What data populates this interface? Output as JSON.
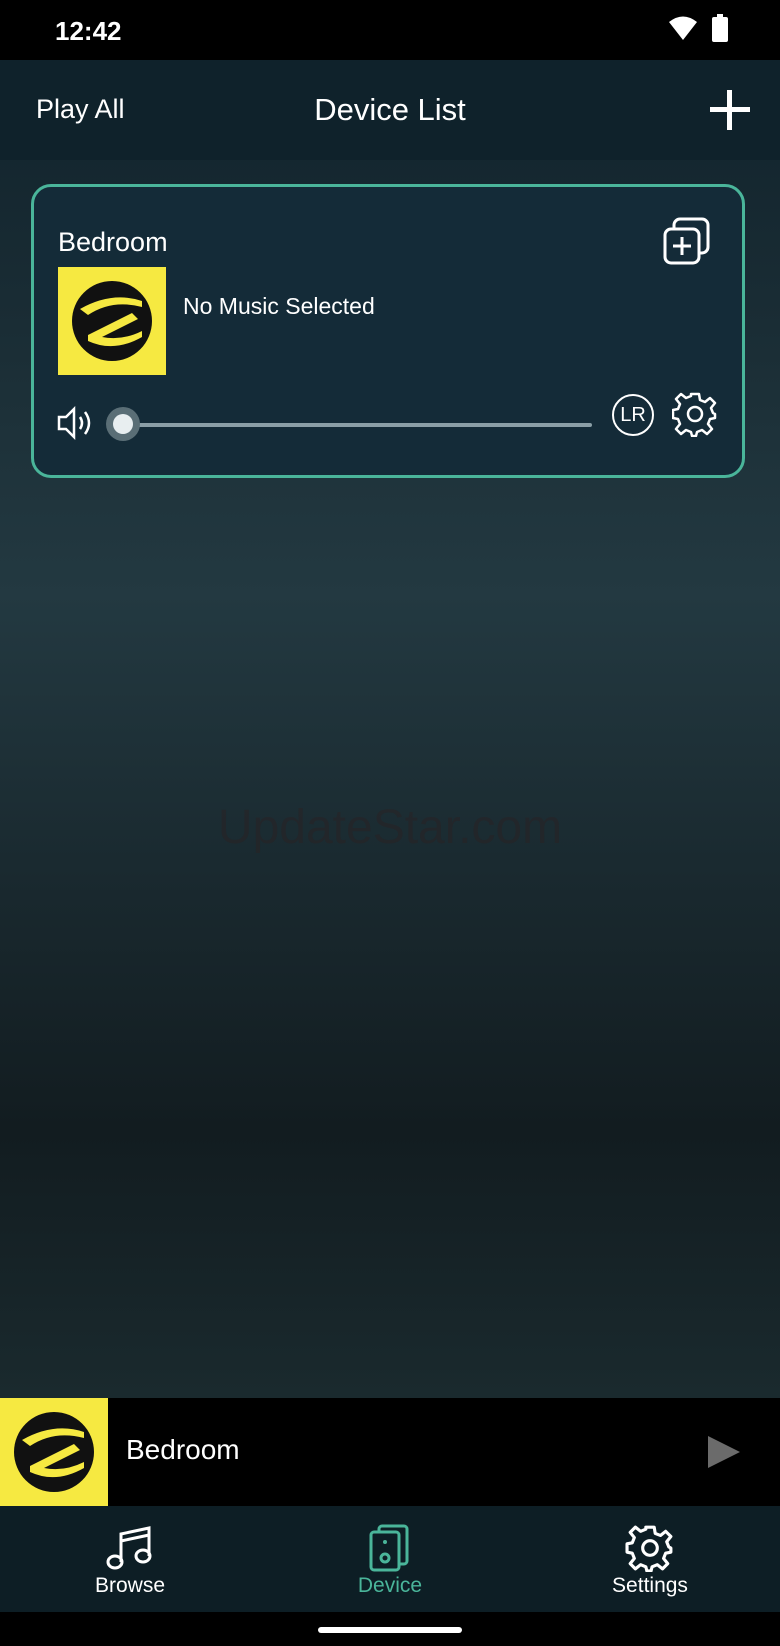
{
  "status": {
    "time": "12:42"
  },
  "header": {
    "play_all": "Play All",
    "title": "Device List"
  },
  "device": {
    "name": "Bedroom",
    "track": "No Music Selected",
    "lr_label": "LR",
    "volume": 0
  },
  "watermark": "UpdateStar.com",
  "mini_player": {
    "title": "Bedroom"
  },
  "tabs": [
    {
      "label": "Browse",
      "icon": "music-note-icon",
      "active": false
    },
    {
      "label": "Device",
      "icon": "speaker-icon",
      "active": true
    },
    {
      "label": "Settings",
      "icon": "gear-icon",
      "active": false
    }
  ],
  "colors": {
    "accent": "#4ab59a",
    "art_bg": "#f6e941",
    "card_bg": "#142b38"
  }
}
